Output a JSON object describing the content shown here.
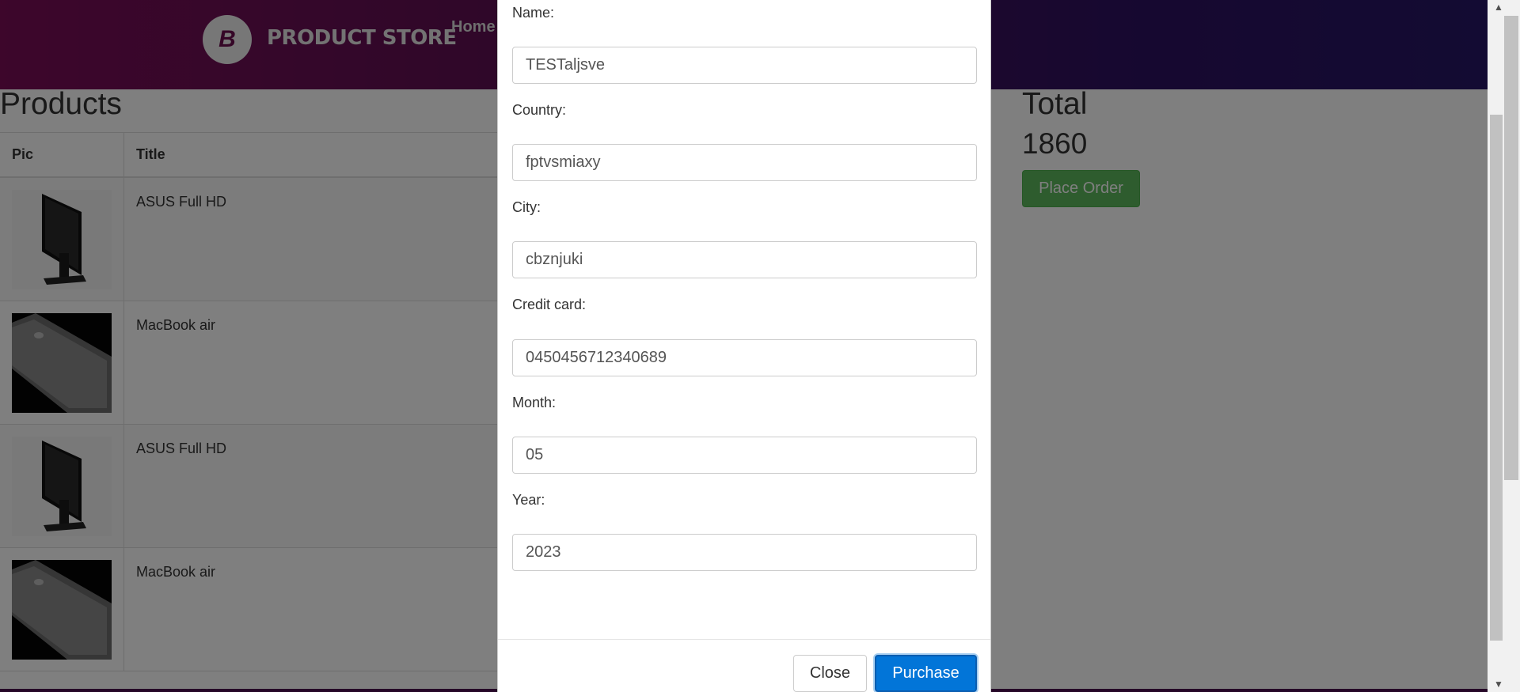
{
  "navbar": {
    "logo_letter": "B",
    "brand": "PRODUCT STORE",
    "home": "Home"
  },
  "products": {
    "title": "Products",
    "columns": [
      "Pic",
      "Title"
    ],
    "rows": [
      {
        "title": "ASUS Full HD",
        "image": "monitor-image"
      },
      {
        "title": "MacBook air",
        "image": "laptop-image"
      },
      {
        "title": "ASUS Full HD",
        "image": "monitor-image"
      },
      {
        "title": "MacBook air",
        "image": "laptop-image"
      }
    ]
  },
  "summary": {
    "total_label": "Total",
    "total_value": "1860",
    "place_order": "Place Order"
  },
  "modal": {
    "fields": [
      {
        "label": "Name:",
        "value": "TESTaljsve"
      },
      {
        "label": "Country:",
        "value": "fptvsmiaxy"
      },
      {
        "label": "City:",
        "value": "cbznjuki"
      },
      {
        "label": "Credit card:",
        "value": "0450456712340689"
      },
      {
        "label": "Month:",
        "value": "05"
      },
      {
        "label": "Year:",
        "value": "2023"
      }
    ],
    "close": "Close",
    "purchase": "Purchase"
  },
  "colors": {
    "navbar_start": "#7a0d57",
    "navbar_end": "#261766",
    "place_order": "#5cb85c",
    "purchase": "#0275d8"
  }
}
